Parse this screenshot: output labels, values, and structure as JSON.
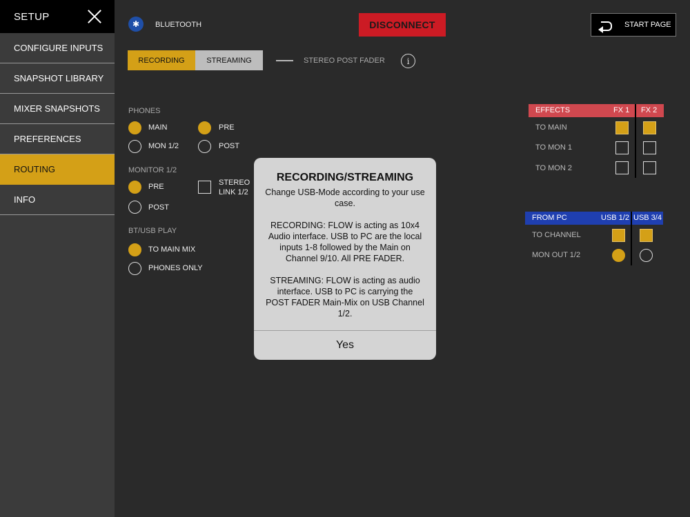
{
  "sidebar": {
    "title": "SETUP",
    "items": [
      {
        "label": "CONFIGURE INPUTS"
      },
      {
        "label": "SNAPSHOT LIBRARY"
      },
      {
        "label": "MIXER SNAPSHOTS"
      },
      {
        "label": "PREFERENCES"
      },
      {
        "label": "ROUTING"
      },
      {
        "label": "INFO"
      }
    ],
    "active": "ROUTING"
  },
  "header": {
    "bluetooth_label": "BLUETOOTH",
    "disconnect_label": "DISCONNECT",
    "start_page_label": "START PAGE"
  },
  "mode": {
    "recording_label": "RECORDING",
    "streaming_label": "STREAMING",
    "selected": "RECORDING",
    "fader_label": "STEREO POST FADER"
  },
  "phones": {
    "title": "PHONES",
    "main": "MAIN",
    "mon": "MON 1/2",
    "pre": "PRE",
    "post": "POST",
    "source_selected": "MAIN",
    "tap_selected": "PRE"
  },
  "monitor": {
    "title": "MONITOR 1/2",
    "pre": "PRE",
    "post": "POST",
    "selected": "PRE",
    "stereo_link_line1": "STEREO",
    "stereo_link_line2": "LINK 1/2",
    "stereo_link_checked": false
  },
  "bt_usb": {
    "title": "BT/USB PLAY",
    "to_main": "TO MAIN MIX",
    "phones_only": "PHONES ONLY",
    "selected": "TO MAIN MIX"
  },
  "effects": {
    "header": "EFFECTS",
    "col1": "FX 1",
    "col2": "FX 2",
    "rows": [
      {
        "label": "TO MAIN",
        "fx1": true,
        "fx2": true
      },
      {
        "label": "TO MON 1",
        "fx1": false,
        "fx2": false
      },
      {
        "label": "TO MON 2",
        "fx1": false,
        "fx2": false
      }
    ]
  },
  "from_pc": {
    "header": "FROM PC",
    "col1": "USB 1/2",
    "col2": "USB 3/4",
    "to_channel": "TO CHANNEL",
    "mon_out": "MON OUT 1/2",
    "to_channel_usb12": true,
    "to_channel_usb34": true,
    "mon_out_selected": "USB 1/2"
  },
  "dialog": {
    "title": "RECORDING/STREAMING",
    "body": "Change USB-Mode according to your use case.\n\nRECORDING: FLOW is acting as 10x4 Audio interface. USB to PC are the local inputs 1-8 followed by the Main on Channel 9/10. All PRE FADER.\n\nSTREAMING: FLOW is acting as audio interface. USB to PC is carrying the POST FADER Main-Mix on USB Channel 1/2.",
    "button": "Yes"
  },
  "colors": {
    "accent": "#d4a017",
    "disconnect": "#cc1b24",
    "effects_header": "#d0484f",
    "from_pc_header": "#1f3fb0",
    "bluetooth": "#1f4fa8"
  }
}
